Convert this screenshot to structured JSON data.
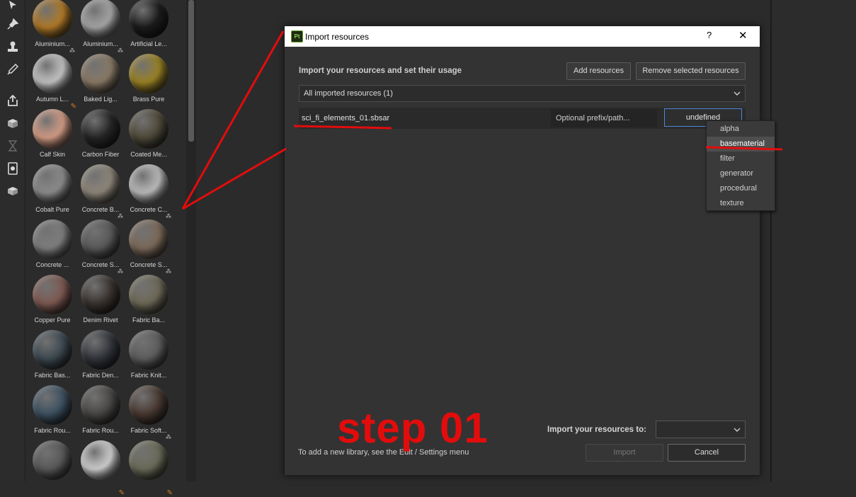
{
  "toolbar": {
    "icons": [
      "selection-tool-icon",
      "pin-tool-icon",
      "stamp-tool-icon",
      "picker-tool-icon",
      "export-icon",
      "bake-icon",
      "hourglass-icon",
      "document-icon",
      "cube-icon"
    ]
  },
  "shelf": {
    "materials": [
      {
        "label": "Aluminium...",
        "color": "#b07a28",
        "badge": "⁂"
      },
      {
        "label": "Aluminium...",
        "color": "#a6a6a6",
        "badge": "⁂"
      },
      {
        "label": "Artificial Le...",
        "color": "#1c1c1c",
        "badge": ""
      },
      {
        "label": "Autumn L...",
        "color": "#c4c4c4",
        "badge": "brush"
      },
      {
        "label": "Baked Lig...",
        "color": "#8a7a66",
        "badge": ""
      },
      {
        "label": "Brass Pure",
        "color": "#9a8224",
        "badge": ""
      },
      {
        "label": "Calf Skin",
        "color": "#d49c86",
        "badge": ""
      },
      {
        "label": "Carbon Fiber",
        "color": "#262626",
        "badge": ""
      },
      {
        "label": "Coated Me...",
        "color": "#4f4a3a",
        "badge": ""
      },
      {
        "label": "Cobalt Pure",
        "color": "#8c8c8c",
        "badge": ""
      },
      {
        "label": "Concrete B...",
        "color": "#8e867a",
        "badge": "⁂"
      },
      {
        "label": "Concrete C...",
        "color": "#bcbcbc",
        "badge": "⁂"
      },
      {
        "label": "Concrete ...",
        "color": "#7e7e7e",
        "badge": ""
      },
      {
        "label": "Concrete S...",
        "color": "#5a5a5a",
        "badge": "⁂"
      },
      {
        "label": "Concrete S...",
        "color": "#7c6a5a",
        "badge": "⁂"
      },
      {
        "label": "Copper Pure",
        "color": "#7e5a52",
        "badge": ""
      },
      {
        "label": "Denim Rivet",
        "color": "#3a3430",
        "badge": ""
      },
      {
        "label": "Fabric Ba...",
        "color": "#6e6a58",
        "badge": ""
      },
      {
        "label": "Fabric Bas...",
        "color": "#3e4a52",
        "badge": ""
      },
      {
        "label": "Fabric Den...",
        "color": "#33363c",
        "badge": ""
      },
      {
        "label": "Fabric Knit...",
        "color": "#5e5e5e",
        "badge": ""
      },
      {
        "label": "Fabric Rou...",
        "color": "#3e5262",
        "badge": ""
      },
      {
        "label": "Fabric Rou...",
        "color": "#4a4846",
        "badge": ""
      },
      {
        "label": "Fabric Soft...",
        "color": "#4a3a32",
        "badge": "⁂"
      },
      {
        "label": "",
        "color": "#5a5a5a",
        "badge": ""
      },
      {
        "label": "",
        "color": "#cfcfcf",
        "badge": "brush"
      },
      {
        "label": "",
        "color": "#6c6c5a",
        "badge": "brush"
      }
    ]
  },
  "dialog": {
    "title": "Import resources",
    "app_icon": "Pt",
    "help": "?",
    "close": "✕",
    "heading": "Import your resources and set their usage",
    "add_label": "Add resources",
    "remove_label": "Remove selected resources",
    "filter_value": "All imported resources (1)",
    "resource": {
      "name": "sci_fi_elements_01.sbsar",
      "prefix_placeholder": "Optional prefix/path...",
      "usage": "undefined"
    },
    "usage_options": [
      "alpha",
      "basematerial",
      "filter",
      "generator",
      "procedural",
      "texture"
    ],
    "usage_highlighted": "basematerial",
    "note": "To add a new library, see the Edit / Settings menu",
    "target_label": "Import your resources to:",
    "target_value": "",
    "import_label": "Import",
    "cancel_label": "Cancel"
  },
  "annotation": {
    "step_label": "step 01",
    "color": "#e30c0c"
  }
}
